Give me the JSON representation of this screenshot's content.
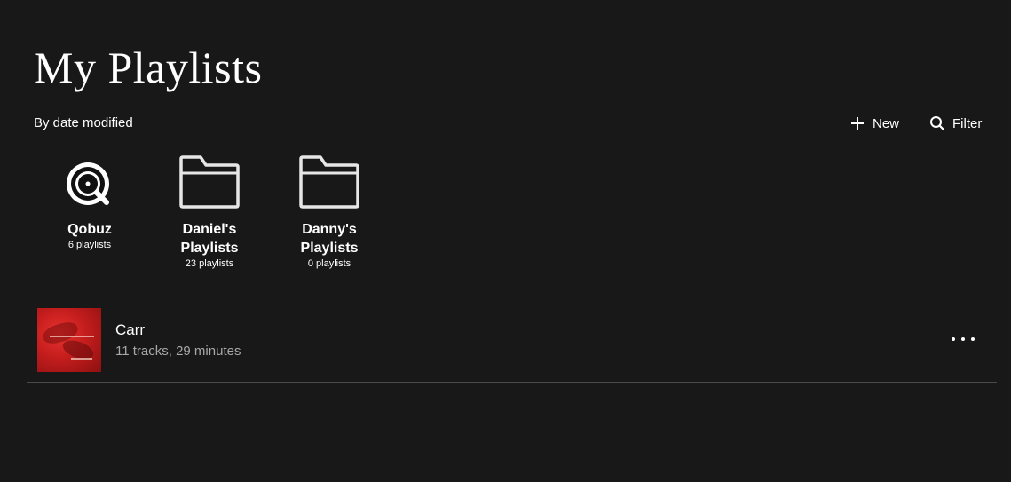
{
  "header": {
    "title": "My Playlists",
    "sort_label": "By date modified",
    "new_label": "New",
    "filter_label": "Filter"
  },
  "folders": [
    {
      "name": "Qobuz",
      "count": "6 playlists",
      "icon": "qobuz-logo-icon"
    },
    {
      "name": "Daniel's Playlists",
      "count": "23 playlists",
      "icon": "folder-icon"
    },
    {
      "name": "Danny's Playlists",
      "count": "0 playlists",
      "icon": "folder-icon"
    }
  ],
  "playlists": [
    {
      "title": "Carr",
      "meta": "11 tracks, 29 minutes",
      "cover_color": "#c41d1d"
    }
  ],
  "colors": {
    "background": "#181818",
    "text": "#ffffff",
    "muted": "#a8a8a8",
    "divider": "#4a4a4a"
  }
}
